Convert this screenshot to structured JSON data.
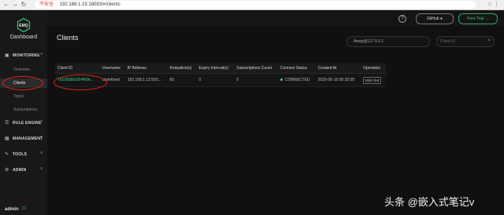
{
  "browser": {
    "security": "不安全",
    "url": "192.168.1.15:18083/#/clients"
  },
  "sidebar": {
    "logo": "EMQ",
    "brand": "Dashboard",
    "groups": {
      "monitoring": "MONITORING",
      "rule_engine": "RULE ENGINE",
      "management": "MANAGEMENT",
      "tools": "TOOLS",
      "admin": "ADMIN"
    },
    "items": {
      "overview": "Overview",
      "clients": "Clients",
      "topics": "Topics",
      "subscriptions": "Subscriptions"
    },
    "user": "admin"
  },
  "header": {
    "github_label": "GitHub",
    "trial_label": "Free Trial"
  },
  "page": {
    "title": "Clients",
    "node_select": "emqx@127.0.0.1",
    "search_placeholder": "Client ID"
  },
  "table": {
    "headers": {
      "client_id": "Client ID",
      "username": "Username",
      "ip": "IP Address",
      "keepalive": "Keepalive(s)",
      "expiry": "Expiry Interval(s)",
      "subs": "Subscriptions Count",
      "status": "Connect Status",
      "created": "Created At",
      "operation": "Operation"
    },
    "rows": [
      {
        "client_id": "7b108b8d1f54f60e...",
        "username": "undefined",
        "ip": "192.168.1.12:503...",
        "keepalive": "60",
        "expiry": "0",
        "subs": "0",
        "status": "CONNECTED",
        "created": "2020-05-16 00:33:05",
        "operation": "Kick Out"
      }
    ]
  },
  "watermark": "头条 @嵌入式笔记v",
  "colors": {
    "accent": "#2fd181",
    "highlight": "#e0261b",
    "background": "#0d0d0d"
  }
}
